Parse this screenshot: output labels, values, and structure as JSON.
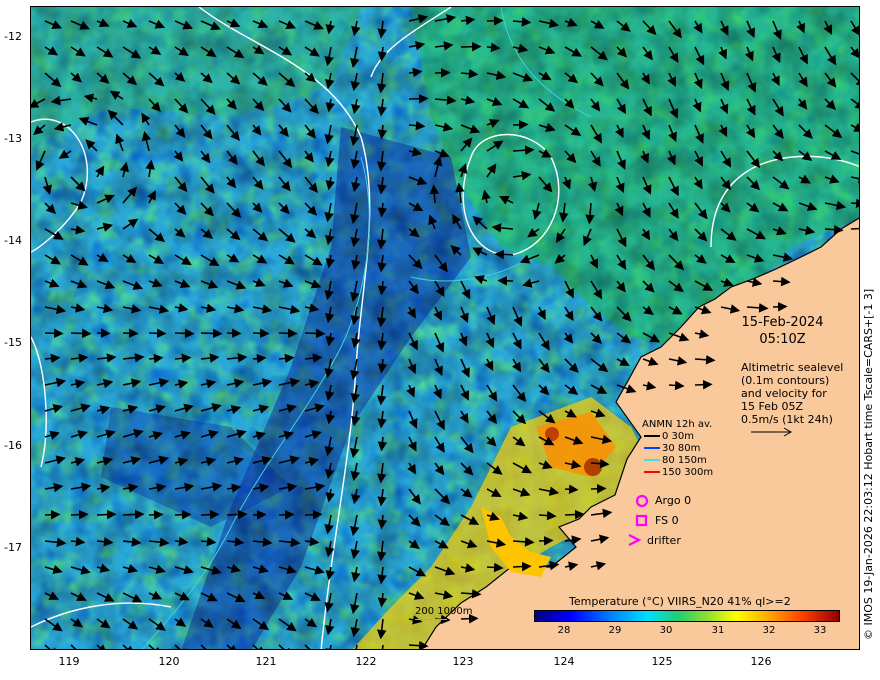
{
  "map": {
    "lat_ticks": [
      "-12",
      "-13",
      "-14",
      "-15",
      "-16",
      "-17"
    ],
    "lon_ticks": [
      "119",
      "120",
      "121",
      "122",
      "123",
      "124",
      "125",
      "126"
    ],
    "lat_range": [
      -17.9,
      -11.7
    ],
    "lon_range": [
      118.6,
      126.9
    ]
  },
  "annotations": {
    "date": "15-Feb-2024",
    "time": "05:10Z",
    "altimetry_lines": [
      "Altimetric sealevel",
      "(0.1m contours)",
      "and velocity for",
      "15 Feb 05Z",
      "0.5m/s (1kt 24h)"
    ]
  },
  "anmn_legend": {
    "title": "ANMN 12h av.",
    "items": [
      {
        "label": "0 30m",
        "color": "#000000"
      },
      {
        "label": "30 80m",
        "color": "#0040ff"
      },
      {
        "label": "80 150m",
        "color": "#40e0e0"
      },
      {
        "label": "150 300m",
        "color": "#ff0000"
      }
    ]
  },
  "platforms": {
    "argo": "Argo 0",
    "fs": "FS 0",
    "drifter": "drifter"
  },
  "colorbar": {
    "title": "Temperature (°C) VIIRS_N20 41% ql>=2",
    "ticks": [
      "28",
      "29",
      "30",
      "31",
      "32",
      "33"
    ]
  },
  "depth_legend": "200  1000m",
  "credit": "© IMOS 19-Jan-2026 22:03:12 Hobart time Tscale=CARS+[-1 3]",
  "colors": {
    "land": "#f9c89b",
    "contour": "#ffffff",
    "isobath": "#40d0e0",
    "marker": "#ff00ff"
  }
}
